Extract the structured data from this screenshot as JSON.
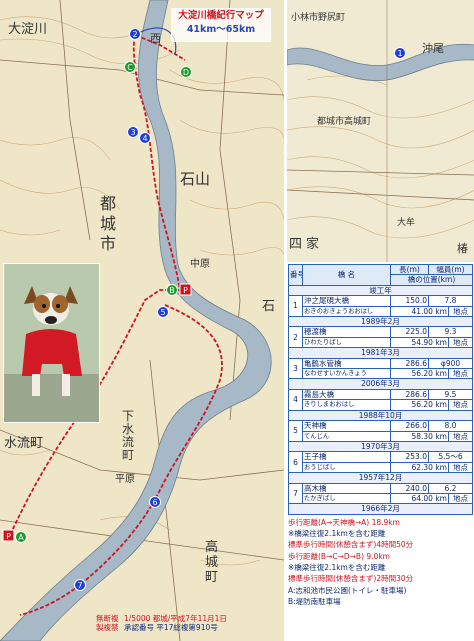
{
  "title": {
    "line1": "大淀川橋紀行マップ",
    "line2": "41km〜65km"
  },
  "main_map_labels": {
    "l1": "大淀川",
    "l2": "西",
    "l3": "都",
    "l4": "城",
    "l5": "市",
    "l6": "石山",
    "l7": "下水流町",
    "l8": "水流町",
    "l9": "高城町",
    "l10": "平原",
    "l11": "中原",
    "l12": "石"
  },
  "inset_labels": {
    "l1": "小林市野尻町",
    "l2": "沖尾",
    "l3": "都城市高城町",
    "l4": "四家",
    "l5": "大牟",
    "l6": "椿"
  },
  "markers": {
    "m1": "1",
    "m2": "2",
    "m3": "3",
    "m4": "4",
    "m5": "5",
    "m6": "6",
    "m7": "7",
    "a": "A",
    "b": "B",
    "c": "C",
    "d": "D",
    "p1": "P",
    "p2": "P"
  },
  "table": {
    "col_number": "番号",
    "col_name": "橋 名",
    "col_length": "長(m)",
    "col_width": "幅員(m)",
    "col_location": "橋の位置(km)",
    "col_unit": "地点",
    "completion": "竣工年",
    "rows": [
      {
        "num": "1",
        "name": "沖之尾硯大橋",
        "kana": "おきのおきょうおおはし",
        "length": "150.0",
        "width": "7.8",
        "km": "41.00 km",
        "unit": "地点",
        "year": "1989年2月"
      },
      {
        "num": "2",
        "name": "穂渡橋",
        "kana": "ひわたりばし",
        "length": "225.0",
        "width": "9.3",
        "km": "54.90 km",
        "unit": "地点",
        "year": "1981年3月"
      },
      {
        "num": "3",
        "name": "亀鶴水管橋",
        "kana": "なわせすいかんきょう",
        "length": "286.6",
        "width": "φ900",
        "km": "56.20 km",
        "unit": "地点",
        "year": "2006年3月"
      },
      {
        "num": "4",
        "name": "霧島大橋",
        "kana": "きりしまおおはし",
        "length": "286.6",
        "width": "9.5",
        "km": "56.20 km",
        "unit": "地点",
        "year": "1988年10月"
      },
      {
        "num": "5",
        "name": "天神橋",
        "kana": "てんじん",
        "length": "266.0",
        "width": "8.0",
        "km": "58.30 km",
        "unit": "地点",
        "year": "1970年3月"
      },
      {
        "num": "6",
        "name": "王子橋",
        "kana": "おうじばし",
        "length": "253.0",
        "width": "5.5〜6",
        "km": "62.30 km",
        "unit": "地点",
        "year": "1957年12月"
      },
      {
        "num": "7",
        "name": "高木橋",
        "kana": "たかぎばし",
        "length": "240.0",
        "width": "6.2",
        "km": "64.00 km",
        "unit": "地点",
        "year": "1966年2月"
      }
    ]
  },
  "notes": {
    "n1": "歩行距離(A→天神橋→A) 18.9km",
    "n2": "※橋梁往復2.1kmを含む距離",
    "n3": "標準歩行時間(休憩含まず)4時間50分",
    "n4": "歩行距離(B→C→D→B) 9.0km",
    "n5": "※橋梁往復2.1kmを含む距離",
    "n6": "標準歩行時間(休憩含まず)2時間30分",
    "n7": "A:志和池市民公園(トイレ・駐車場)",
    "n8": "B:堤防南駐車場"
  },
  "footer": {
    "label1": "無断複",
    "text1": "1/5000 都城/平成7年11月1日",
    "label2": "製複禁",
    "text2": "承認番号 平17総複第910号"
  },
  "colors": {
    "route_red": "#d0141f",
    "route_blue": "#2a48b8",
    "marker_blue": "#1f3fd6",
    "marker_green": "#1b9a2a",
    "river": "#9fb3c2"
  }
}
